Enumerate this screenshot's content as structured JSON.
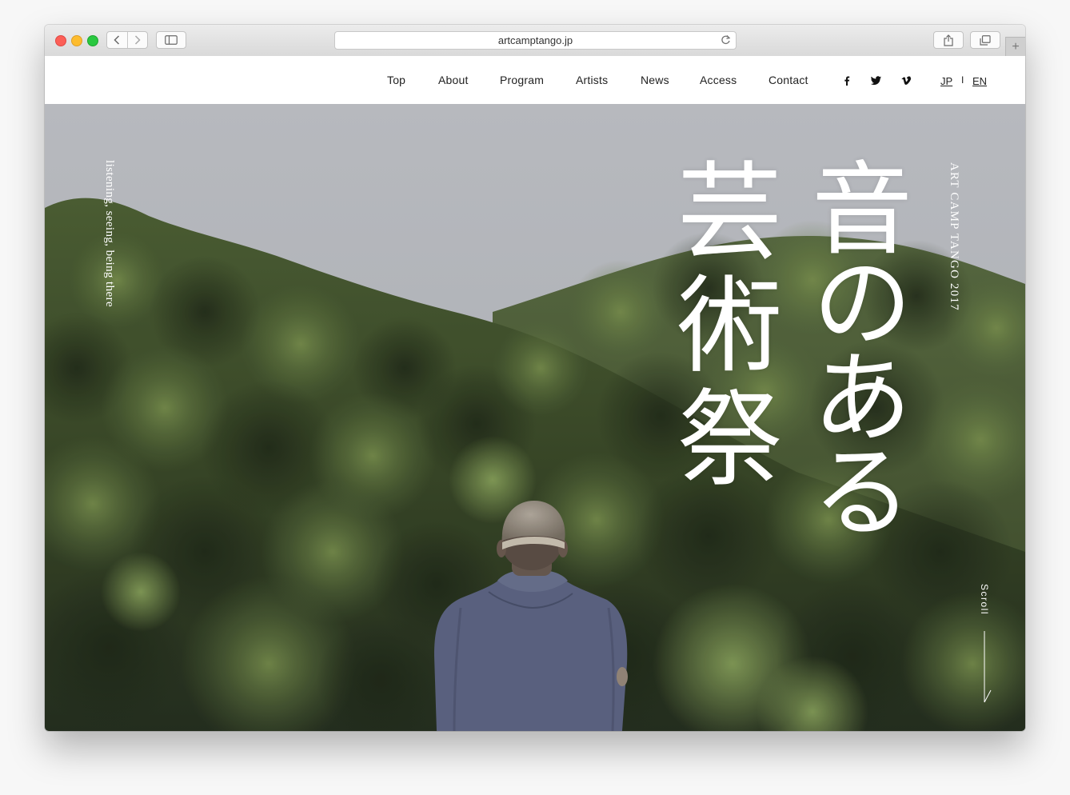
{
  "browser": {
    "url": "artcamptango.jp",
    "new_tab_glyph": "+"
  },
  "nav": {
    "items": [
      "Top",
      "About",
      "Program",
      "Artists",
      "News",
      "Access",
      "Contact"
    ],
    "social": [
      "facebook-icon",
      "twitter-icon",
      "vimeo-icon"
    ],
    "languages": [
      "JP",
      "EN"
    ],
    "lang_separator": "I"
  },
  "hero": {
    "tagline": "listening, seeing, being there",
    "title_col1": "音のある",
    "title_col2": "芸術祭",
    "event_name": "ART CAMP TANGO 2017",
    "scroll_label": "Scroll"
  },
  "colors": {
    "sky": "#bfc2c7",
    "forest_dark": "#2f3a25",
    "forest_mid": "#4d6233",
    "jacket": "#5e6685",
    "text_light": "#ffffff"
  }
}
